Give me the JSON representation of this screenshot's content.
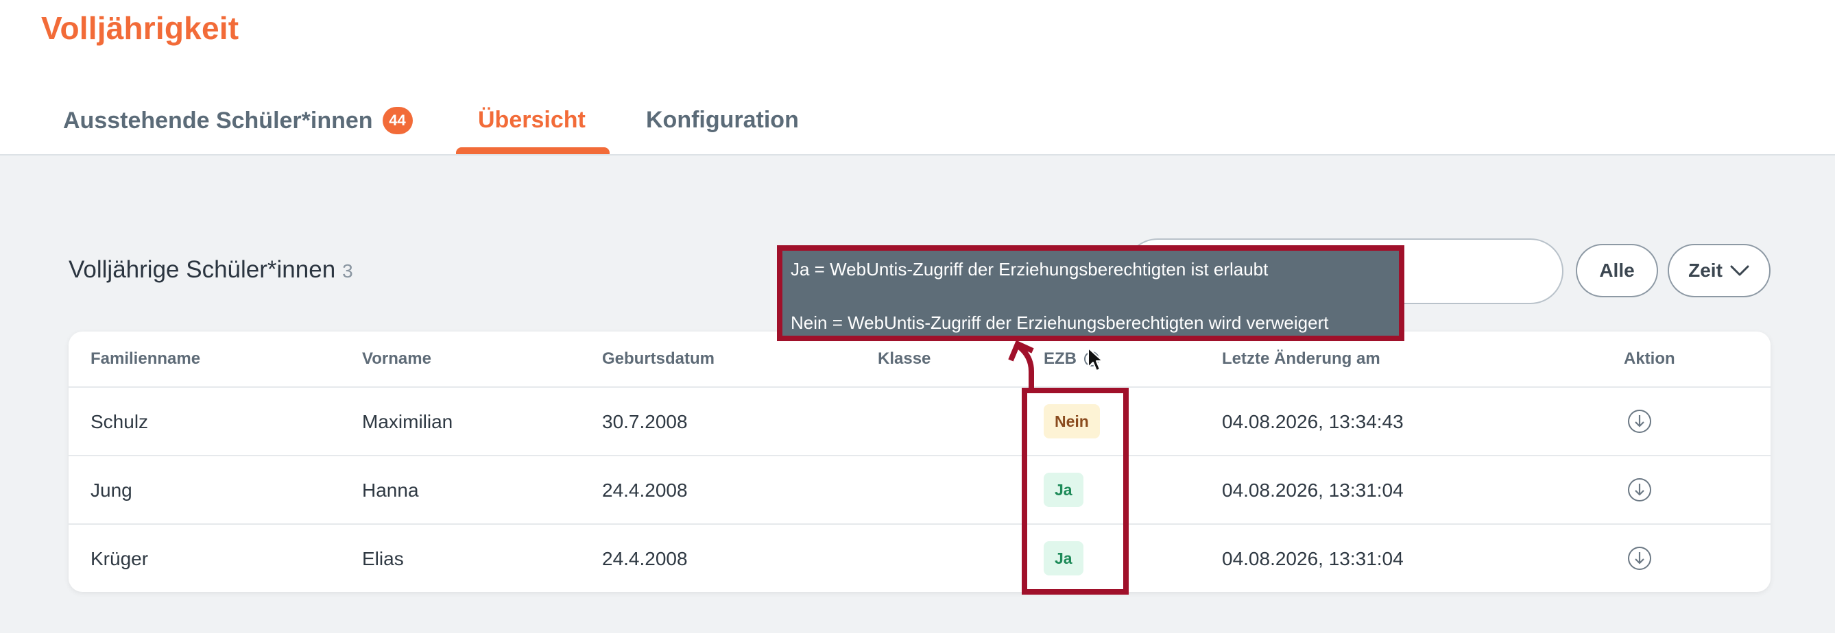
{
  "page": {
    "title": "Volljährigkeit"
  },
  "tabs": {
    "pending": {
      "label": "Ausstehende Schüler*innen",
      "badge": "44"
    },
    "overview": {
      "label": "Übersicht"
    },
    "config": {
      "label": "Konfiguration"
    }
  },
  "section": {
    "title": "Volljährige Schüler*innen",
    "count": "3"
  },
  "filters": {
    "search_value": "",
    "all_label": "Alle",
    "time_label": "Zeit"
  },
  "table": {
    "headers": {
      "lastname": "Familienname",
      "firstname": "Vorname",
      "birthdate": "Geburtsdatum",
      "class": "Klasse",
      "ezb": "EZB",
      "changed": "Letzte Änderung am",
      "action": "Aktion"
    },
    "rows": [
      {
        "lastname": "Schulz",
        "firstname": "Maximilian",
        "birthdate": "30.7.2008",
        "class": "",
        "ezb": "Nein",
        "changed": "04.08.2026, 13:34:43"
      },
      {
        "lastname": "Jung",
        "firstname": "Hanna",
        "birthdate": "24.4.2008",
        "class": "",
        "ezb": "Ja",
        "changed": "04.08.2026, 13:31:04"
      },
      {
        "lastname": "Krüger",
        "firstname": "Elias",
        "birthdate": "24.4.2008",
        "class": "",
        "ezb": "Ja",
        "changed": "04.08.2026, 13:31:04"
      }
    ]
  },
  "tooltip": {
    "line1": "Ja = WebUntis-Zugriff der Erziehungsberechtigten ist erlaubt",
    "line2": "Nein = WebUntis-Zugriff der Erziehungsberechtigten wird verweigert"
  },
  "colors": {
    "accent": "#f26b38",
    "annotation": "#a0102a",
    "tooltip_bg": "#5e6d78",
    "tag_no_bg": "#fdf3d5",
    "tag_yes_bg": "#e0f7ec"
  }
}
